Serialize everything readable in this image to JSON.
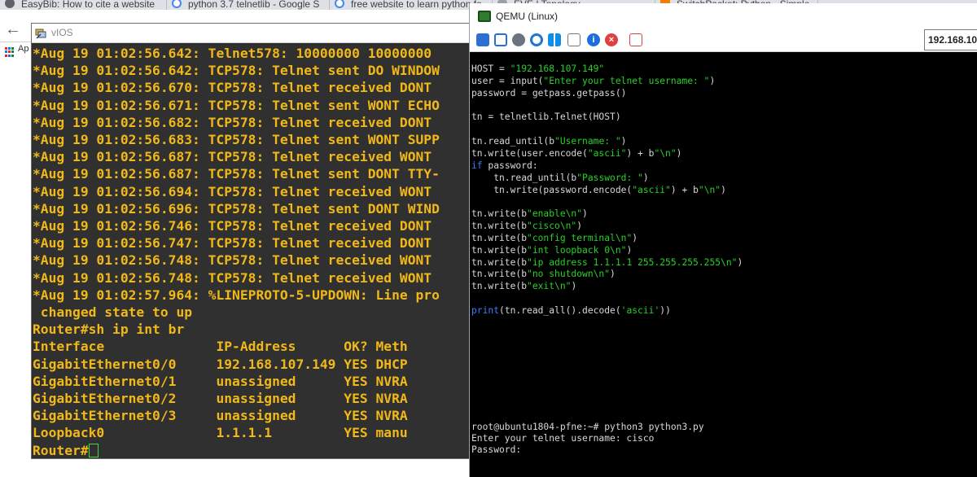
{
  "browser": {
    "tabs": [
      {
        "label": "EasyBib: How to cite a website",
        "icon": "globe-icon"
      },
      {
        "label": "python 3.7 telnetlib - Google S",
        "icon": "google-icon"
      },
      {
        "label": "free website to learn python fo",
        "icon": "google-icon"
      },
      {
        "label": "EVE | Topology",
        "icon": "eve-icon"
      },
      {
        "label": "SwitchPacket: Python - Simple",
        "icon": "blogger-icon"
      }
    ],
    "bookmarks_label": "Ap"
  },
  "vios": {
    "title": "vIOS",
    "lines": [
      "*Aug 19 01:02:56.642: Telnet578: 10000000 10000000",
      "*Aug 19 01:02:56.642: TCP578: Telnet sent DO WINDOW",
      "*Aug 19 01:02:56.670: TCP578: Telnet received DONT",
      "*Aug 19 01:02:56.671: TCP578: Telnet sent WONT ECHO",
      "*Aug 19 01:02:56.682: TCP578: Telnet received DONT",
      "*Aug 19 01:02:56.683: TCP578: Telnet sent WONT SUPP",
      "*Aug 19 01:02:56.687: TCP578: Telnet received WONT",
      "*Aug 19 01:02:56.687: TCP578: Telnet sent DONT TTY-",
      "*Aug 19 01:02:56.694: TCP578: Telnet received WONT",
      "*Aug 19 01:02:56.696: TCP578: Telnet sent DONT WIND",
      "*Aug 19 01:02:56.746: TCP578: Telnet received DONT",
      "*Aug 19 01:02:56.747: TCP578: Telnet received DONT",
      "*Aug 19 01:02:56.748: TCP578: Telnet received WONT",
      "*Aug 19 01:02:56.748: TCP578: Telnet received WONT",
      "*Aug 19 01:02:57.964: %LINEPROTO-5-UPDOWN: Line pro",
      " changed state to up",
      "Router#sh ip int br",
      "Interface              IP-Address      OK? Meth",
      "GigabitEthernet0/0     192.168.107.149 YES DHCP",
      "GigabitEthernet0/1     unassigned      YES NVRA",
      "GigabitEthernet0/2     unassigned      YES NVRA",
      "GigabitEthernet0/3     unassigned      YES NVRA",
      "Loopback0              1.1.1.1         YES manu"
    ],
    "prompt": "Router#"
  },
  "qemu": {
    "title": "QEMU (Linux)",
    "address": "192.168.10",
    "toolbar_icons": [
      "gear-cluster-icon",
      "fullscreen-icon",
      "settings-icon",
      "refresh-icon",
      "windows-icon",
      "usb-icon",
      "info-icon",
      "close-icon",
      "file-transfer-icon"
    ],
    "code": [
      [
        {
          "t": "HOST = "
        },
        {
          "t": "\"192.168.107.149\"",
          "c": "s"
        }
      ],
      [
        {
          "t": "user = input("
        },
        {
          "t": "\"Enter your telnet username: \"",
          "c": "s"
        },
        {
          "t": ")"
        }
      ],
      [
        {
          "t": "password = getpass.getpass()"
        }
      ],
      [],
      [
        {
          "t": "tn = telnetlib.Telnet(HOST)"
        }
      ],
      [],
      [
        {
          "t": "tn.read_until(b"
        },
        {
          "t": "\"Username: \"",
          "c": "s"
        },
        {
          "t": ")"
        }
      ],
      [
        {
          "t": "tn.write(user.encode("
        },
        {
          "t": "\"ascii\"",
          "c": "s"
        },
        {
          "t": ") + b"
        },
        {
          "t": "\"\\n\"",
          "c": "s"
        },
        {
          "t": ")"
        }
      ],
      [
        {
          "t": "if",
          "c": "k"
        },
        {
          "t": " password:"
        }
      ],
      [
        {
          "t": "    tn.read_until(b"
        },
        {
          "t": "\"Password: \"",
          "c": "s"
        },
        {
          "t": ")"
        }
      ],
      [
        {
          "t": "    tn.write(password.encode("
        },
        {
          "t": "\"ascii\"",
          "c": "s"
        },
        {
          "t": ") + b"
        },
        {
          "t": "\"\\n\"",
          "c": "s"
        },
        {
          "t": ")"
        }
      ],
      [],
      [
        {
          "t": "tn.write(b"
        },
        {
          "t": "\"enable\\n\"",
          "c": "s"
        },
        {
          "t": ")"
        }
      ],
      [
        {
          "t": "tn.write(b"
        },
        {
          "t": "\"cisco\\n\"",
          "c": "s"
        },
        {
          "t": ")"
        }
      ],
      [
        {
          "t": "tn.write(b"
        },
        {
          "t": "\"config terminal\\n\"",
          "c": "s"
        },
        {
          "t": ")"
        }
      ],
      [
        {
          "t": "tn.write(b"
        },
        {
          "t": "\"int loopback 0\\n\"",
          "c": "s"
        },
        {
          "t": ")"
        }
      ],
      [
        {
          "t": "tn.write(b"
        },
        {
          "t": "\"ip address 1.1.1.1 255.255.255.255\\n\"",
          "c": "s"
        },
        {
          "t": ")"
        }
      ],
      [
        {
          "t": "tn.write(b"
        },
        {
          "t": "\"no shutdown\\n\"",
          "c": "s"
        },
        {
          "t": ")"
        }
      ],
      [
        {
          "t": "tn.write(b"
        },
        {
          "t": "\"exit\\n\"",
          "c": "s"
        },
        {
          "t": ")"
        }
      ],
      [],
      [
        {
          "t": "print",
          "c": "k"
        },
        {
          "t": "(tn.read_all().decode("
        },
        {
          "t": "'ascii'",
          "c": "s"
        },
        {
          "t": "))"
        }
      ]
    ],
    "shell": [
      "root@ubuntu1804-pfne:~# python3 python3.py",
      "Enter your telnet username: cisco",
      "Password:"
    ]
  }
}
